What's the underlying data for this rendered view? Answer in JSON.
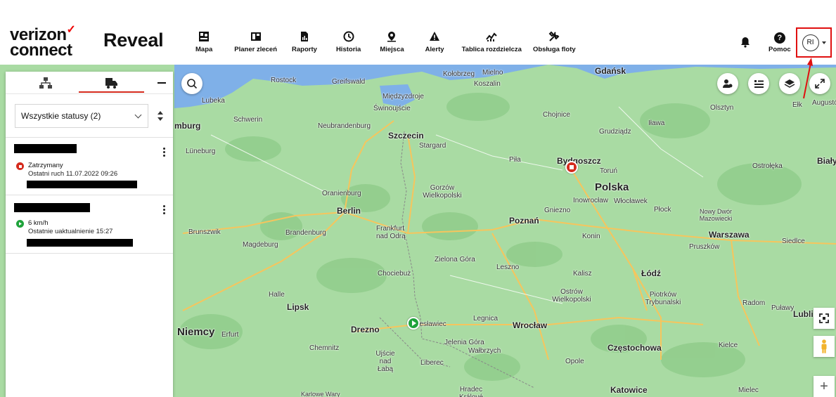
{
  "brand": {
    "vendor": "verizon",
    "vendor2": "connect",
    "product": "Reveal"
  },
  "nav": [
    {
      "label": "Mapa",
      "icon": "map-icon"
    },
    {
      "label": "Planer zleceń",
      "icon": "planner-icon"
    },
    {
      "label": "Raporty",
      "icon": "reports-icon"
    },
    {
      "label": "Historia",
      "icon": "history-icon"
    },
    {
      "label": "Miejsca",
      "icon": "places-icon"
    },
    {
      "label": "Alerty",
      "icon": "alerts-icon"
    },
    {
      "label": "Tablica rozdzielcza",
      "icon": "dashboard-icon"
    },
    {
      "label": "Obsługa floty",
      "icon": "fleet-service-icon"
    }
  ],
  "header": {
    "help_label": "Pomoc",
    "user_initials": "RI"
  },
  "panel": {
    "status_filter": "Wszystkie statusy (2)",
    "vehicles": [
      {
        "status": "Zatrzymany",
        "time": "Ostatni ruch 11.07.2022 09:26",
        "status_color": "#d52b1e"
      },
      {
        "status": "6 km/h",
        "time": "Ostatnie uaktualnienie 15:27",
        "status_color": "#1fa33b"
      }
    ]
  },
  "map_labels": [
    "Kołobrzeg",
    "Mielno",
    "Koszalin",
    "Gdańsk",
    "Rostock",
    "Greifswald",
    "Międzyzdroje",
    "Świnoujście",
    "Lubeka",
    "Schwerin",
    "Neubrandenburg",
    "Szczecin",
    "Stargard",
    "Chojnice",
    "Grudziądz",
    "Olsztyn",
    "Iława",
    "Ełk",
    "Augustów",
    "mburg",
    "Lüneburg",
    "Piła",
    "Bydgoszcz",
    "Toruń",
    "Polska",
    "Ostrołęka",
    "Biały",
    "Gorzów Wielkopolski",
    "Oranienburg",
    "Berlin",
    "Brandenburg",
    "Frankfurt nad Odrą",
    "Poznań",
    "Gniezno",
    "Inowrocław",
    "Włocławek",
    "Płock",
    "Nowy Dwór Mazowiecki",
    "Warszawa",
    "Siedlce",
    "Brunszwik",
    "Magdeburg",
    "Konin",
    "Pruszków",
    "Zielona Góra",
    "Leszno",
    "Kalisz",
    "Łódź",
    "Chociebuż",
    "Halle",
    "Ostrów Wielkopolski",
    "Piotrków Trybunalski",
    "Radom",
    "Puławy",
    "Lipsk",
    "Drezno",
    "Legnica",
    "Wrocław",
    "Lubli",
    "Niemcy",
    "Erfurt",
    "Chemnitz",
    "Jelenia Góra",
    "Wałbrzych",
    "Częstochowa",
    "Kielce",
    "Opole",
    "Ujście nad Łabą",
    "Liberec",
    "Hradec Králové",
    "Katowice",
    "Mielec",
    "Karlowe Wary",
    "Bolesławiec"
  ],
  "colors": {
    "accent": "#d52b1e",
    "map_bg": "#a9dba3",
    "water": "#7fb0e8",
    "highlight": "#e01010"
  }
}
